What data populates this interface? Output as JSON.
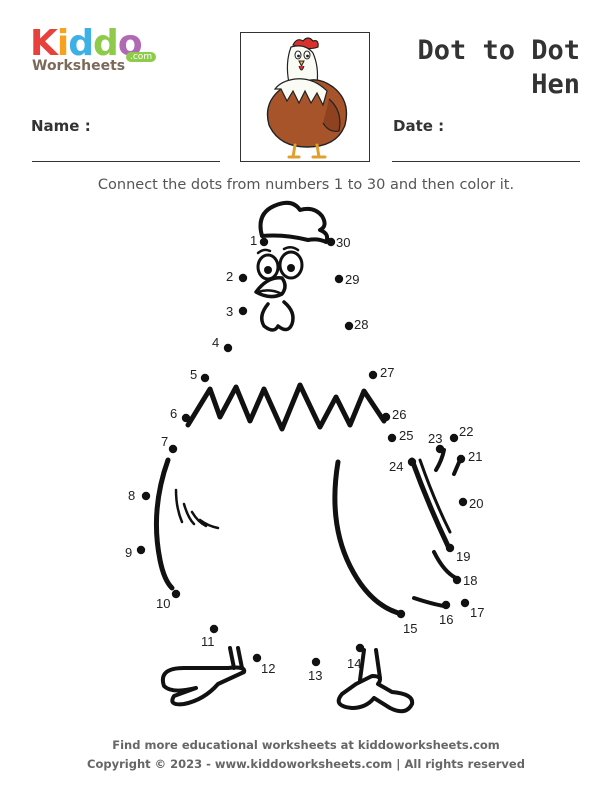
{
  "brand": {
    "logo_letters": [
      "K",
      "i",
      "d",
      "d",
      "o"
    ],
    "logo_colors": [
      "#e8413c",
      "#f6a21c",
      "#3db0e6",
      "#8ecb4a",
      "#b06ab3"
    ],
    "logo_sub": "Worksheets",
    "logo_domain": ".com"
  },
  "title": {
    "line1": "Dot to Dot",
    "line2": "Hen"
  },
  "fields": {
    "name_label": "Name :",
    "date_label": "Date :"
  },
  "instructions": "Connect the dots from numbers 1 to 30 and then color it.",
  "dots": [
    {
      "n": "1"
    },
    {
      "n": "2"
    },
    {
      "n": "3"
    },
    {
      "n": "4"
    },
    {
      "n": "5"
    },
    {
      "n": "6"
    },
    {
      "n": "7"
    },
    {
      "n": "8"
    },
    {
      "n": "9"
    },
    {
      "n": "10"
    },
    {
      "n": "11"
    },
    {
      "n": "12"
    },
    {
      "n": "13"
    },
    {
      "n": "14"
    },
    {
      "n": "15"
    },
    {
      "n": "16"
    },
    {
      "n": "17"
    },
    {
      "n": "18"
    },
    {
      "n": "19"
    },
    {
      "n": "20"
    },
    {
      "n": "21"
    },
    {
      "n": "22"
    },
    {
      "n": "23"
    },
    {
      "n": "24"
    },
    {
      "n": "25"
    },
    {
      "n": "26"
    },
    {
      "n": "27"
    },
    {
      "n": "28"
    },
    {
      "n": "29"
    },
    {
      "n": "30"
    }
  ],
  "footer": {
    "line1": "Find more educational worksheets at kiddoworksheets.com",
    "line2": "Copyright © 2023 - www.kiddoworksheets.com  |  All rights reserved"
  }
}
